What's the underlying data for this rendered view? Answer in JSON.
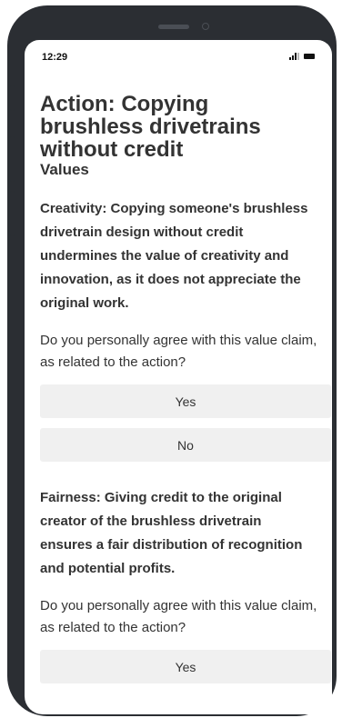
{
  "status_bar": {
    "time": "12:29",
    "icons": [
      "signal-icon",
      "battery-icon"
    ]
  },
  "page": {
    "action_title": "Action: Copying brushless drivetrains without credit",
    "section_title": "Values"
  },
  "values": [
    {
      "claim": "Creativity: Copying someone's brushless drivetrain design without credit undermines the value of creativity and innovation, as it does not appreciate the original work.",
      "question": "Do you personally agree with this value claim, as related to the action?",
      "options": [
        "Yes",
        "No"
      ]
    },
    {
      "claim": "Fairness: Giving credit to the original creator of the brushless drivetrain ensures a fair distribution of recognition and potential profits.",
      "question": "Do you personally agree with this value claim, as related to the action?",
      "options": [
        "Yes"
      ]
    }
  ],
  "colors": {
    "device_frame": "#2b2e33",
    "button_background": "#f0f0f0",
    "text": "#333333"
  }
}
